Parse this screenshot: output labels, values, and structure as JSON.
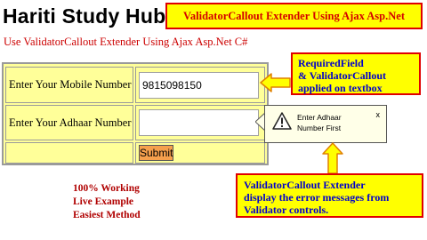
{
  "header": {
    "site_title": "Hariti Study Hub",
    "subtitle": "Use ValidatorCallout Extender Using Ajax Asp.Net C#",
    "banner": "ValidatorCallout Extender Using Ajax Asp.Net"
  },
  "form": {
    "mobile_label": "Enter Your Mobile Number",
    "mobile_value": "9815098150",
    "adhaar_label": "Enter Your Adhaar Number",
    "adhaar_value": "",
    "submit_label": "Submit"
  },
  "callout": {
    "message": "Enter Adhaar Number First",
    "close": "x",
    "icon": "warning-icon"
  },
  "annotations": {
    "note1": [
      "RequiredField",
      "& ValidatorCallout",
      "applied on textbox"
    ],
    "note2": [
      "ValidatorCallout Extender",
      "display the error messages from",
      "Validator controls."
    ],
    "features": [
      "100% Working",
      "Live Example",
      "Easiest Method"
    ]
  },
  "colors": {
    "banner_bg": "#ffff00",
    "banner_border": "#e00000",
    "form_bg": "#ffff99",
    "button_bg": "#f6a04d",
    "note_text": "#0000cc",
    "subtitle_text": "#cc0000"
  }
}
